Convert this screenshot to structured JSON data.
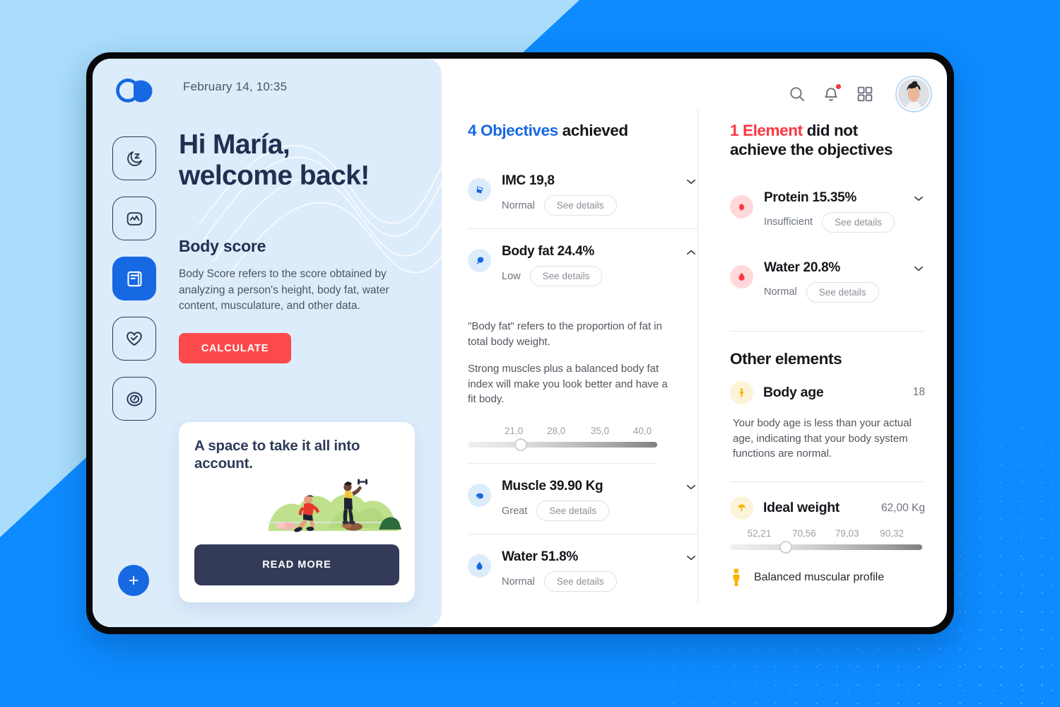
{
  "window": {
    "date_label": "February 14, 10:35",
    "brand_color": "#1668e3",
    "danger_color": "#fb3640",
    "accent_red": "#fc4a4a",
    "accent_yellow": "#f7b500"
  },
  "topbar": {
    "search_icon": "search-icon",
    "notifications_icon": "bell-icon",
    "apps_icon": "grid-icon",
    "avatar_icon": "avatar"
  },
  "sidebar": {
    "logo": "brand-logo",
    "add_label": "+",
    "items": [
      {
        "icon": "moon-sleep-icon",
        "name": "sleep",
        "active": false
      },
      {
        "icon": "activity-chart-icon",
        "name": "activity",
        "active": false
      },
      {
        "icon": "report-document-icon",
        "name": "report",
        "active": true
      },
      {
        "icon": "heart-icon",
        "name": "heart",
        "active": false
      },
      {
        "icon": "gauge-icon",
        "name": "gauge",
        "active": false
      }
    ]
  },
  "hero": {
    "greeting_line1": "Hi María,",
    "greeting_line2": "welcome back!",
    "section_title": "Body score",
    "description": "Body Score refers to the score obtained by analyzing a person's height, body fat, water content, musculature, and other data.",
    "cta_label": "CALCULATE"
  },
  "promo": {
    "title": "A space to take it all into account.",
    "button_label": "READ MORE"
  },
  "achieved": {
    "count": "4 Objectives",
    "heading_rest": "achieved",
    "metrics": [
      {
        "icon": "bmi-scale-icon",
        "title": "IMC 19,8",
        "status": "Normal",
        "details_label": "See details",
        "chevron": "chevron-down-icon",
        "expanded": false
      },
      {
        "icon": "body-fat-drop-icon",
        "title": "Body fat 24.4%",
        "status": "Low",
        "details_label": "See details",
        "chevron": "chevron-up-icon",
        "expanded": true,
        "paragraph_1": "\"Body fat\" refers to the proportion of fat in total body weight.",
        "paragraph_2": "Strong muscles plus a balanced body fat index will make you look better and have a fit body."
      },
      {
        "icon": "muscle-arm-icon",
        "title": "Muscle 39.90 Kg",
        "status": "Great",
        "details_label": "See details",
        "chevron": "chevron-down-icon",
        "expanded": false
      },
      {
        "icon": "water-drop-icon",
        "title": "Water 51.8%",
        "status": "Normal",
        "details_label": "See details",
        "chevron": "chevron-down-icon",
        "expanded": false
      }
    ]
  },
  "not_achieved": {
    "count": "1 Element",
    "heading_rest_line1": "did not",
    "heading_rest_line2": "achieve the objectives",
    "metrics": [
      {
        "icon": "protein-drop-icon",
        "title": "Protein 15.35%",
        "status": "Insufficient",
        "details_label": "See details",
        "chevron": "chevron-down-icon"
      },
      {
        "icon": "water-drop-red-icon",
        "title": "Water 20.8%",
        "status": "Normal",
        "details_label": "See details",
        "chevron": "chevron-down-icon"
      }
    ]
  },
  "other_elements": {
    "heading": "Other elements",
    "body_age": {
      "icon": "person-standing-icon",
      "label": "Body age",
      "value": "18",
      "description": "Your body age is less than your actual age, indicating that your body system functions are normal."
    },
    "ideal_weight": {
      "icon": "weight-arrow-icon",
      "label": "Ideal weight",
      "value": "62,00 Kg"
    },
    "profile": {
      "icon": "person-profile-icon",
      "label": "Balanced muscular profile"
    }
  },
  "chart_data": [
    {
      "type": "slider",
      "name": "body-fat-slider",
      "title": "Body fat 24.4%",
      "categories": [
        "21,0",
        "28,0",
        "35,0",
        "40,0"
      ],
      "tick_positions_pct": [
        20,
        38.5,
        57.5,
        76
      ],
      "value": 24.4,
      "value_position_pct": 28,
      "xlabel": "",
      "ylabel": "",
      "grid": false,
      "legend": "none"
    },
    {
      "type": "slider",
      "name": "ideal-weight-slider",
      "title": "Ideal weight",
      "categories": [
        "52,21",
        "70,56",
        "79,03",
        "90,32"
      ],
      "tick_positions_pct": [
        15,
        38,
        60,
        83
      ],
      "value": 62.0,
      "value_position_pct": 29,
      "xlabel": "",
      "ylabel": "",
      "grid": false,
      "legend": "none"
    }
  ]
}
